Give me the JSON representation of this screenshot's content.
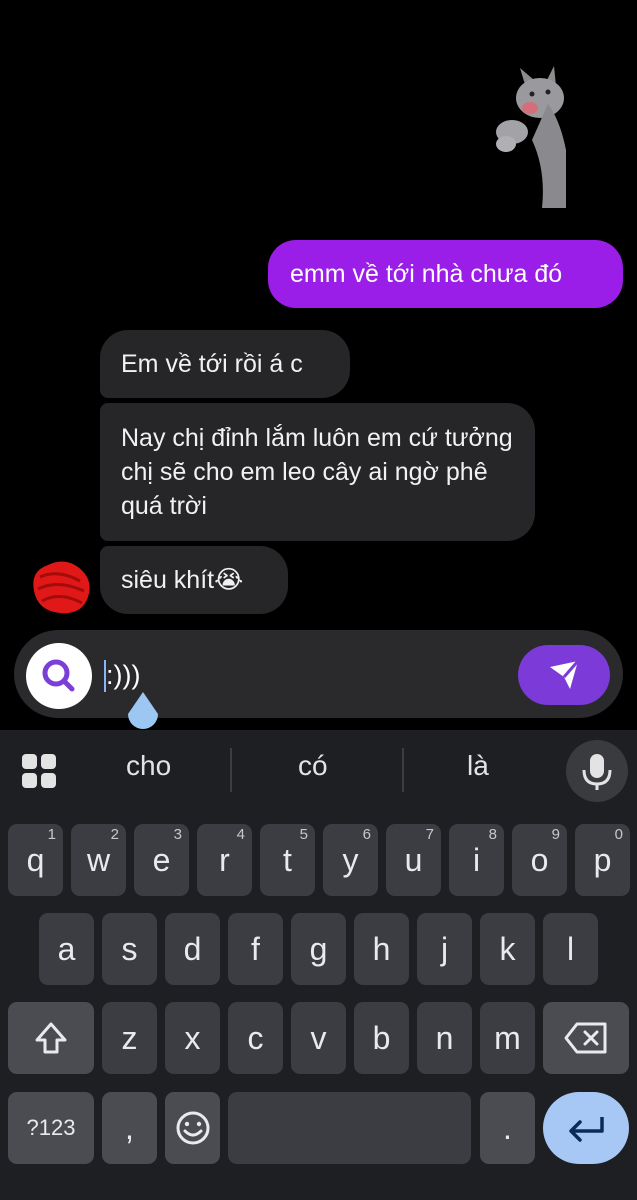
{
  "chat": {
    "messages": [
      {
        "sender": "me",
        "text": "emm về tới nhà chưa đó"
      },
      {
        "sender": "other",
        "text": "Em về tới rồi á c"
      },
      {
        "sender": "other",
        "text": "Nay chị đỉnh lắm luôn em cứ tưởng chị sẽ cho em leo cây ai ngờ phê quá trời"
      },
      {
        "sender": "other",
        "text": "siêu khít😭"
      }
    ]
  },
  "composer": {
    "value": ":)))"
  },
  "keyboard": {
    "suggestions": [
      "cho",
      "có",
      "là"
    ],
    "row1": [
      {
        "key": "q",
        "num": "1"
      },
      {
        "key": "w",
        "num": "2"
      },
      {
        "key": "e",
        "num": "3"
      },
      {
        "key": "r",
        "num": "4"
      },
      {
        "key": "t",
        "num": "5"
      },
      {
        "key": "y",
        "num": "6"
      },
      {
        "key": "u",
        "num": "7"
      },
      {
        "key": "i",
        "num": "8"
      },
      {
        "key": "o",
        "num": "9"
      },
      {
        "key": "p",
        "num": "0"
      }
    ],
    "row2": [
      "a",
      "s",
      "d",
      "f",
      "g",
      "h",
      "j",
      "k",
      "l"
    ],
    "row3": [
      "z",
      "x",
      "c",
      "v",
      "b",
      "n",
      "m"
    ],
    "symbols_label": "?123",
    "comma_label": ",",
    "period_label": "."
  },
  "colors": {
    "outgoing_bubble": "#9b1ee8",
    "incoming_bubble": "#262628",
    "send_button": "#7c3ad8",
    "enter_key": "#a7c8f5"
  }
}
